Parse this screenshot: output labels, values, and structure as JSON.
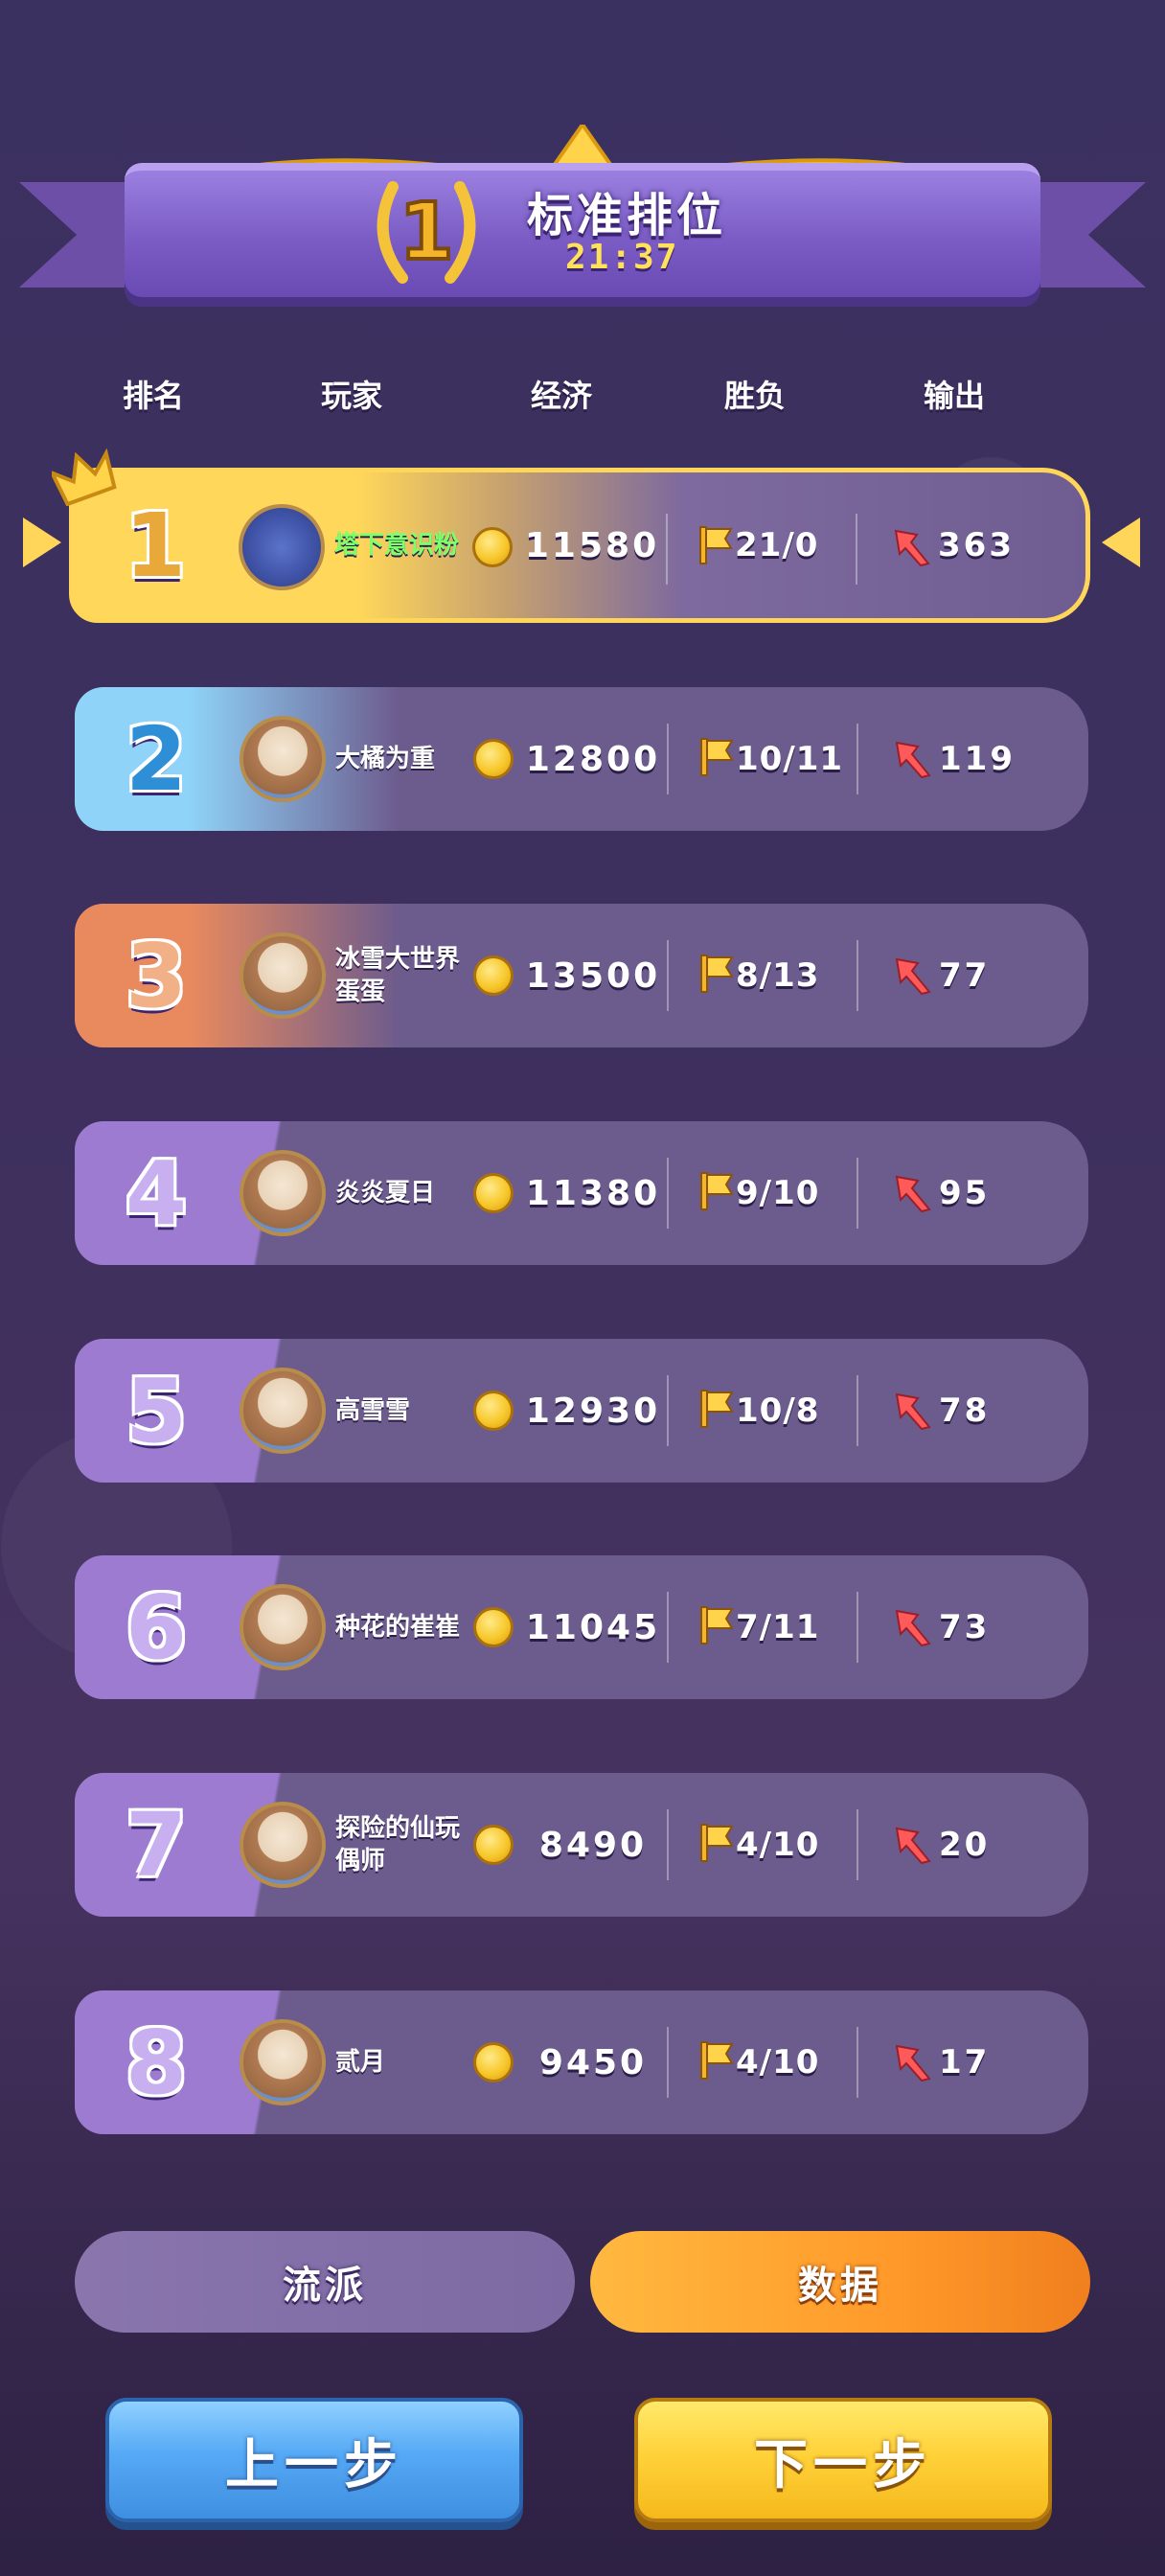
{
  "banner": {
    "rank_badge": "1",
    "title": "标准排位",
    "time": "21:37"
  },
  "headers": {
    "rank": "排名",
    "player": "玩家",
    "economy": "经济",
    "winloss": "胜负",
    "damage": "输出"
  },
  "rows": [
    {
      "rank": "1",
      "name": "塔下意识粉",
      "gold": "11580",
      "winloss": "21/0",
      "damage": "363",
      "rank_color": "#ffd75a",
      "num_color": "#e9a93a"
    },
    {
      "rank": "2",
      "name": "大橘为重",
      "gold": "12800",
      "winloss": "10/11",
      "damage": "119",
      "rank_color": "#8fd3f8",
      "num_color": "#2f8fd6"
    },
    {
      "rank": "3",
      "name": "冰雪大世界蛋蛋",
      "gold": "13500",
      "winloss": "8/13",
      "damage": "77",
      "rank_color": "#e98a5e",
      "num_color": "#f2b086"
    },
    {
      "rank": "4",
      "name": "炎炎夏日",
      "gold": "11380",
      "winloss": "9/10",
      "damage": "95",
      "rank_color": "#9c7bd0",
      "num_color": "#c8b0f0"
    },
    {
      "rank": "5",
      "name": "高雪雪",
      "gold": "12930",
      "winloss": "10/8",
      "damage": "78",
      "rank_color": "#9c7bd0",
      "num_color": "#c8b0f0"
    },
    {
      "rank": "6",
      "name": "种花的崔崔",
      "gold": "11045",
      "winloss": "7/11",
      "damage": "73",
      "rank_color": "#9c7bd0",
      "num_color": "#c8b0f0"
    },
    {
      "rank": "7",
      "name": "探险的仙玩偶师",
      "gold": "8490",
      "winloss": "4/10",
      "damage": "20",
      "rank_color": "#9c7bd0",
      "num_color": "#c8b0f0"
    },
    {
      "rank": "8",
      "name": "贰月",
      "gold": "9450",
      "winloss": "4/10",
      "damage": "17",
      "rank_color": "#9c7bd0",
      "num_color": "#c8b0f0"
    }
  ],
  "tabs": {
    "style_label": "流派",
    "data_label": "数据"
  },
  "buttons": {
    "prev_label": "上一步",
    "next_label": "下一步"
  },
  "colors": {
    "accent_gold": "#ffd75a",
    "name_highlight": "#7dff6a",
    "row_bg": "#6c5b8d",
    "tab_active": "#ff9a2a",
    "btn_prev": "#55a9f5",
    "btn_next": "#ffd23a"
  },
  "icons": {
    "coin": "coin-icon",
    "flag": "flag-icon",
    "damage": "damage-icon",
    "crown": "crown-icon",
    "laurel": "laurel-icon"
  }
}
